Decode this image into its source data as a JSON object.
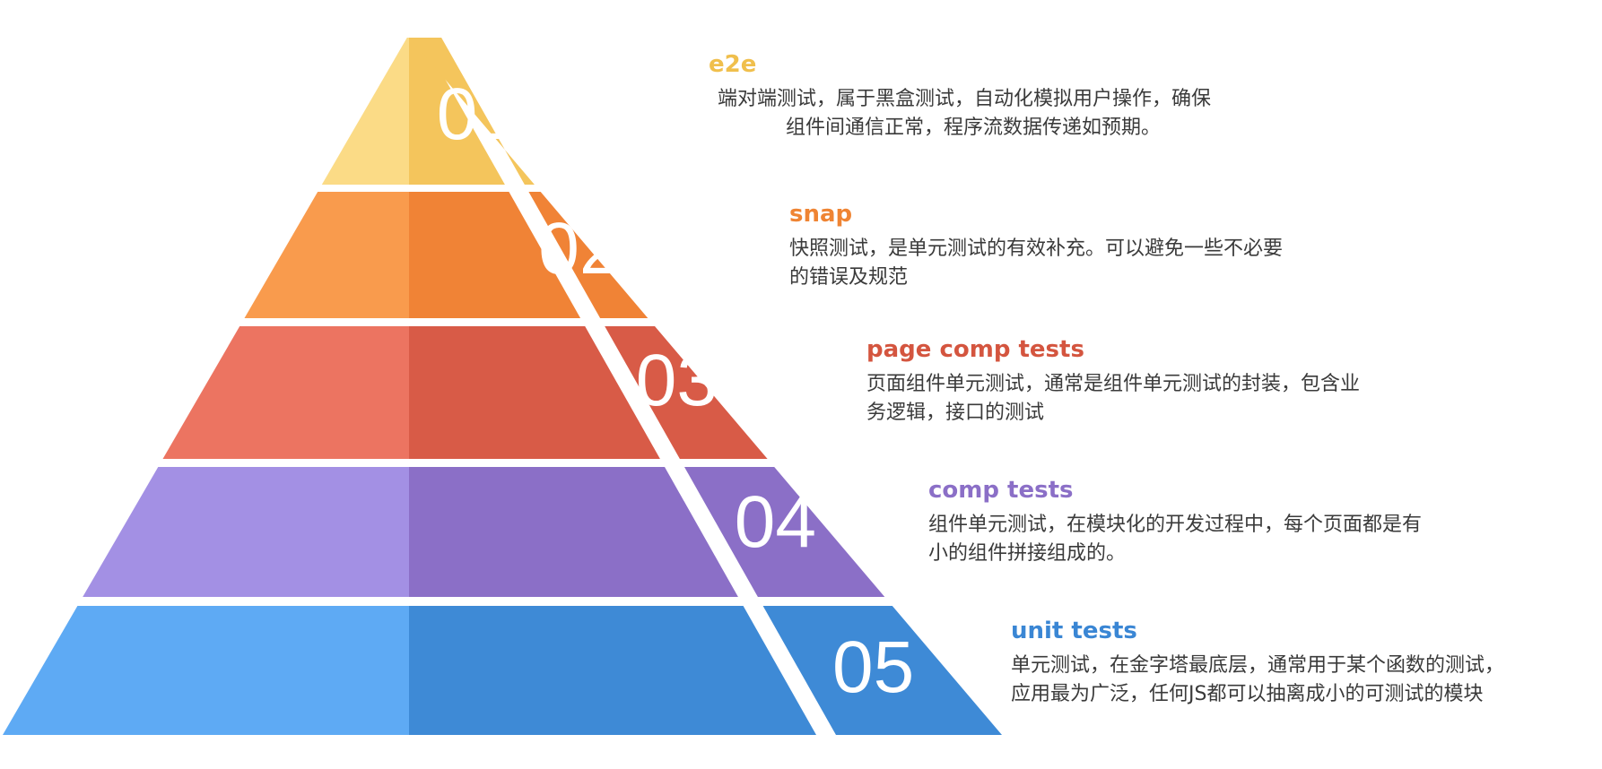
{
  "levels": [
    {
      "number": "01",
      "title": "e2e",
      "desc_lines": [
        "端对端测试，属于黑盒测试，自动化模拟用户操作，确保",
        "组件间通信正常，程序流数据传递如预期。"
      ],
      "colors": {
        "light": "#fbdb86",
        "dark": "#f4c55c",
        "title": "#f0bf4c"
      }
    },
    {
      "number": "02",
      "title": "snap",
      "desc_lines": [
        "快照测试，是单元测试的有效补充。可以避免一些不必要",
        "的错误及规范"
      ],
      "colors": {
        "light": "#f99b4d",
        "dark": "#f08336",
        "title": "#ef8433"
      }
    },
    {
      "number": "03",
      "title": "page comp tests",
      "desc_lines": [
        "页面组件单元测试，通常是组件单元测试的封装，包含业",
        "务逻辑，接口的测试"
      ],
      "colors": {
        "light": "#ec7461",
        "dark": "#d85b47",
        "title": "#d4553f"
      }
    },
    {
      "number": "04",
      "title": "comp tests",
      "desc_lines": [
        "组件单元测试，在模块化的开发过程中，每个页面都是有",
        "小的组件拼接组成的。"
      ],
      "colors": {
        "light": "#a390e4",
        "dark": "#8b6fc7",
        "title": "#8b6fc7"
      }
    },
    {
      "number": "05",
      "title": "unit tests",
      "desc_lines": [
        "单元测试，在金字塔最底层，通常用于某个函数的测试，",
        "应用最为广泛，任何JS都可以抽离成小的可测试的模块"
      ],
      "colors": {
        "light": "#5eaaf4",
        "dark": "#3e8ad6",
        "title": "#3a86d4"
      }
    }
  ]
}
